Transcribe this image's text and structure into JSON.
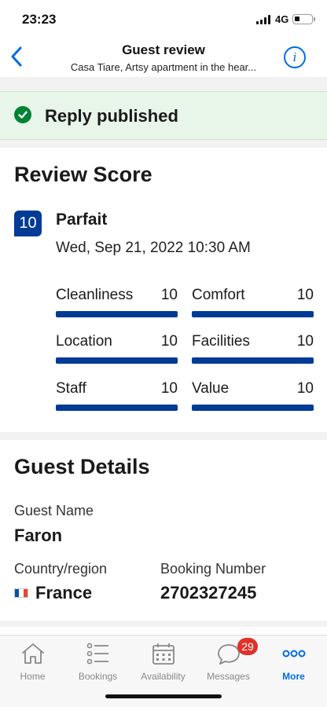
{
  "status_bar": {
    "time": "23:23",
    "network": "4G",
    "battery_level": 0.25
  },
  "header": {
    "title": "Guest review",
    "subtitle": "Casa Tiare, Artsy apartment in the hear...",
    "back_icon": "chevron-left-icon",
    "info_icon": "info-icon"
  },
  "banner": {
    "text": "Reply published",
    "icon": "check-circle-icon",
    "color": "#008234"
  },
  "review": {
    "title": "Review Score",
    "score": "10",
    "rating_word": "Parfait",
    "date": "Wed, Sep 21, 2022 10:30 AM",
    "categories": [
      {
        "label": "Cleanliness",
        "score": "10",
        "fraction": 1.0
      },
      {
        "label": "Comfort",
        "score": "10",
        "fraction": 1.0
      },
      {
        "label": "Location",
        "score": "10",
        "fraction": 1.0
      },
      {
        "label": "Facilities",
        "score": "10",
        "fraction": 1.0
      },
      {
        "label": "Staff",
        "score": "10",
        "fraction": 1.0
      },
      {
        "label": "Value",
        "score": "10",
        "fraction": 1.0
      }
    ]
  },
  "guest": {
    "title": "Guest Details",
    "name_label": "Guest Name",
    "name": "Faron",
    "country_label": "Country/region",
    "country": "France",
    "country_flag_icon": "france-flag-icon",
    "booking_label": "Booking Number",
    "booking_number": "2702327245"
  },
  "tabs": [
    {
      "label": "Home",
      "icon": "home-icon",
      "active": false
    },
    {
      "label": "Bookings",
      "icon": "list-icon",
      "active": false
    },
    {
      "label": "Availability",
      "icon": "calendar-icon",
      "active": false
    },
    {
      "label": "Messages",
      "icon": "chat-bubble-icon",
      "active": false,
      "badge": "29"
    },
    {
      "label": "More",
      "icon": "more-dots-icon",
      "active": true
    }
  ],
  "colors": {
    "accent": "#006ce4",
    "brand_dark": "#003b95",
    "badge_red": "#e0312a",
    "success_bg": "#e8f5e9"
  }
}
